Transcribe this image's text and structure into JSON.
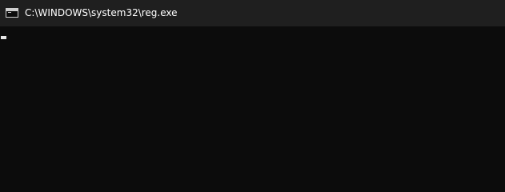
{
  "window": {
    "title": "C:\\WINDOWS\\system32\\reg.exe",
    "icon": "console-icon"
  },
  "console": {
    "text": ""
  },
  "colors": {
    "titlebar": "#1f1f1f",
    "background": "#0c0c0c",
    "text": "#ffffff",
    "cursor": "#e6e6e6"
  }
}
